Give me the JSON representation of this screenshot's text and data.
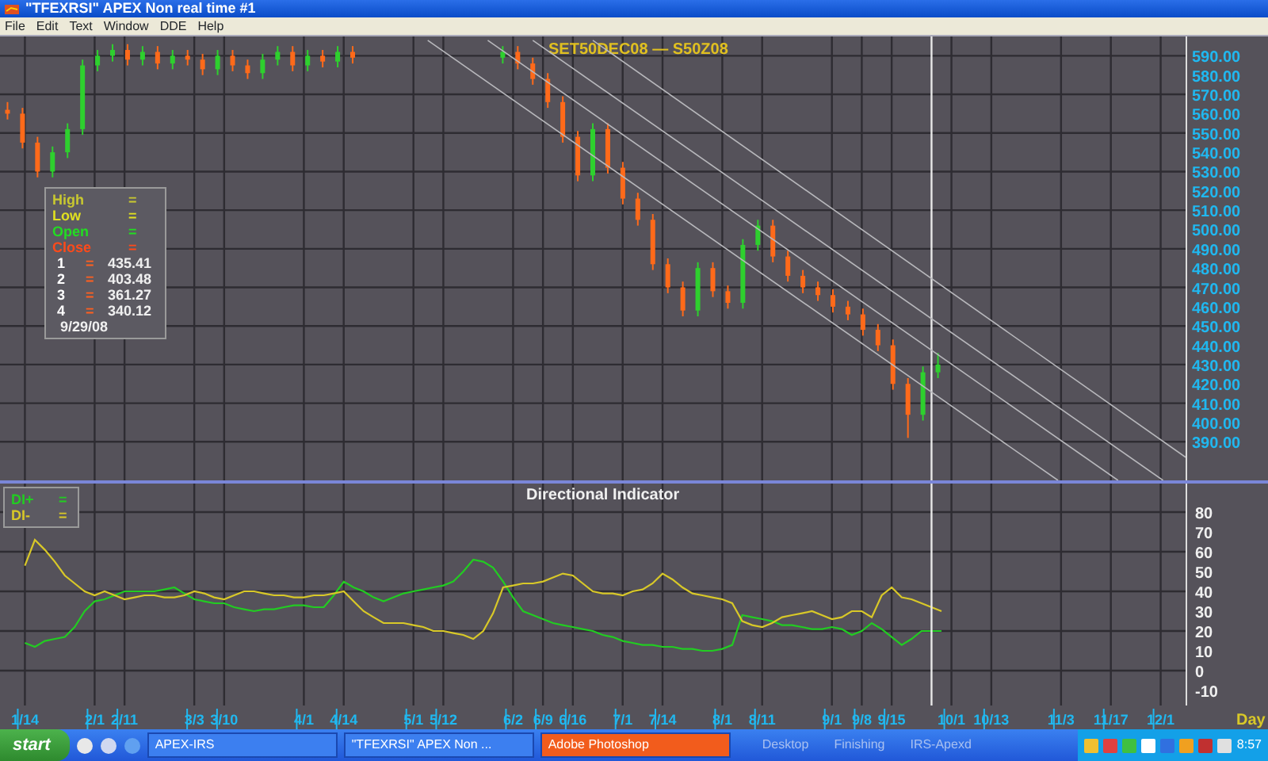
{
  "window": {
    "title": "\"TFEXRSI\" APEX Non real time #1"
  },
  "menu": [
    "File",
    "Edit",
    "Text",
    "Window",
    "DDE",
    "Help"
  ],
  "price_panel": {
    "legend": {
      "fields": [
        {
          "label": "High",
          "sign": "=",
          "color": "#c8c830"
        },
        {
          "label": "Low",
          "sign": "=",
          "color": "#e0e020"
        },
        {
          "label": "Open",
          "sign": "=",
          "color": "#22dd22"
        },
        {
          "label": "Close",
          "sign": "=",
          "color": "#ff4a1a"
        }
      ],
      "levels": [
        {
          "label": "1",
          "sign": "=",
          "value": "435.41"
        },
        {
          "label": "2",
          "sign": "=",
          "value": "403.48"
        },
        {
          "label": "3",
          "sign": "=",
          "value": "361.27"
        },
        {
          "label": "4",
          "sign": "=",
          "value": "340.12"
        }
      ],
      "date": "9/29/08"
    },
    "chart_data": {
      "type": "candlestick",
      "title": "SET50DEC08  —  S50Z08",
      "ylim": [
        370,
        600
      ],
      "grid": true,
      "categories": [
        null,
        null,
        null,
        null,
        null,
        null,
        null,
        null,
        null,
        null,
        null,
        null,
        null,
        null,
        null,
        null,
        null,
        null,
        null,
        null,
        null,
        null,
        null,
        null,
        null,
        null,
        null,
        null,
        null,
        null,
        null,
        null,
        null,
        null,
        null,
        null,
        null,
        null,
        null,
        null,
        null,
        null,
        null,
        null,
        null,
        null,
        null,
        null,
        null,
        null,
        null,
        null,
        null,
        null,
        null,
        null,
        null,
        null,
        null,
        null,
        null,
        null,
        null,
        null,
        null,
        null,
        null,
        null,
        null,
        null,
        null,
        null,
        null,
        null,
        null,
        null,
        null,
        null,
        null
      ],
      "ohlc": [
        [
          562,
          566,
          557,
          560
        ],
        [
          560,
          563,
          542,
          545
        ],
        [
          545,
          548,
          527,
          530
        ],
        [
          530,
          543,
          527,
          540
        ],
        [
          540,
          555,
          537,
          552
        ],
        [
          552,
          588,
          549,
          585
        ],
        [
          585,
          593,
          582,
          590
        ],
        [
          590,
          596,
          587,
          593
        ],
        [
          593,
          596,
          585,
          588
        ],
        [
          588,
          595,
          585,
          592
        ],
        [
          592,
          595,
          583,
          586
        ],
        [
          586,
          593,
          583,
          590
        ],
        [
          590,
          593,
          585,
          588
        ],
        [
          588,
          591,
          580,
          583
        ],
        [
          583,
          593,
          580,
          590
        ],
        [
          590,
          593,
          582,
          585
        ],
        [
          585,
          588,
          578,
          581
        ],
        [
          581,
          591,
          578,
          588
        ],
        [
          588,
          595,
          585,
          592
        ],
        [
          592,
          595,
          582,
          585
        ],
        [
          585,
          593,
          582,
          590
        ],
        [
          590,
          593,
          584,
          587
        ],
        [
          587,
          595,
          584,
          592
        ],
        [
          592,
          595,
          586,
          589
        ],
        null,
        null,
        null,
        null,
        null,
        null,
        null,
        null,
        null,
        [
          589,
          595,
          586,
          592
        ],
        [
          592,
          595,
          583,
          586
        ],
        [
          586,
          589,
          575,
          578
        ],
        [
          578,
          581,
          563,
          566
        ],
        [
          566,
          569,
          545,
          548
        ],
        [
          548,
          551,
          525,
          528
        ],
        [
          528,
          555,
          525,
          552
        ],
        [
          552,
          555,
          529,
          532
        ],
        [
          532,
          535,
          513,
          516
        ],
        [
          516,
          519,
          502,
          505
        ],
        [
          505,
          508,
          479,
          482
        ],
        [
          482,
          485,
          467,
          470
        ],
        [
          470,
          473,
          455,
          458
        ],
        [
          458,
          483,
          455,
          480
        ],
        [
          480,
          483,
          465,
          468
        ],
        [
          468,
          471,
          459,
          462
        ],
        [
          462,
          495,
          459,
          492
        ],
        [
          492,
          505,
          489,
          502
        ],
        [
          502,
          505,
          483,
          486
        ],
        [
          486,
          489,
          473,
          476
        ],
        [
          476,
          479,
          467,
          470
        ],
        [
          470,
          473,
          463,
          466
        ],
        [
          466,
          469,
          457,
          460
        ],
        [
          460,
          463,
          453,
          456
        ],
        [
          456,
          459,
          445,
          448
        ],
        [
          448,
          451,
          437,
          440
        ],
        [
          440,
          443,
          417,
          420
        ],
        [
          420,
          423,
          392,
          404
        ],
        [
          404,
          429,
          401,
          426
        ],
        [
          426,
          436,
          423,
          430
        ],
        null,
        null,
        null,
        null,
        null,
        null,
        null,
        null,
        null,
        null,
        null,
        null,
        null,
        null,
        null,
        null
      ],
      "yticks": [
        {
          "value": 390,
          "label": "390.00"
        },
        {
          "value": 400,
          "label": "400.00"
        },
        {
          "value": 410,
          "label": "410.00"
        },
        {
          "value": 420,
          "label": "420.00"
        },
        {
          "value": 430,
          "label": "430.00"
        },
        {
          "value": 440,
          "label": "440.00"
        },
        {
          "value": 450,
          "label": "450.00"
        },
        {
          "value": 460,
          "label": "460.00"
        },
        {
          "value": 470,
          "label": "470.00"
        },
        {
          "value": 480,
          "label": "480.00"
        },
        {
          "value": 490,
          "label": "490.00"
        },
        {
          "value": 500,
          "label": "500.00"
        },
        {
          "value": 510,
          "label": "510.00"
        },
        {
          "value": 520,
          "label": "520.00"
        },
        {
          "value": 530,
          "label": "530.00"
        },
        {
          "value": 540,
          "label": "540.00"
        },
        {
          "value": 550,
          "label": "550.00"
        },
        {
          "value": 560,
          "label": "560.00"
        },
        {
          "value": 570,
          "label": "570.00"
        },
        {
          "value": 580,
          "label": "580.00"
        },
        {
          "value": 590,
          "label": "590.00"
        }
      ]
    }
  },
  "indicator_panel": {
    "legend": [
      {
        "sign": "="
      },
      {
        "sign": "="
      }
    ],
    "chart_data": {
      "type": "line",
      "title": "Directional  Indicator",
      "xlabel": "Day",
      "ylim": [
        -15,
        85
      ],
      "grid": true,
      "categories": [
        null,
        null,
        "1/14",
        null,
        null,
        null,
        null,
        null,
        null,
        "2/1",
        null,
        null,
        "2/11",
        null,
        null,
        null,
        null,
        null,
        null,
        "3/3",
        null,
        null,
        "3/10",
        null,
        null,
        null,
        null,
        null,
        null,
        null,
        "4/1",
        null,
        null,
        null,
        "4/14",
        null,
        null,
        null,
        null,
        null,
        null,
        "5/1",
        null,
        null,
        "5/12",
        null,
        null,
        null,
        null,
        null,
        null,
        "6/2",
        null,
        null,
        "6/9",
        null,
        null,
        "6/16",
        null,
        null,
        null,
        null,
        "7/1",
        null,
        null,
        null,
        "7/14",
        null,
        null,
        null,
        null,
        null,
        "8/1",
        null,
        null,
        null,
        "8/11",
        null,
        null,
        null,
        null,
        null,
        null,
        "9/1",
        null,
        null,
        "9/8",
        null,
        null,
        "9/15",
        null,
        null,
        null,
        null,
        null,
        "10/1",
        null,
        null,
        null,
        "10/13",
        null,
        null,
        null,
        null,
        null,
        null,
        "11/3",
        null,
        null,
        null,
        null,
        "11/17",
        null,
        null,
        null,
        null,
        "12/1",
        null,
        null
      ],
      "series": [
        {
          "name": "DI+",
          "color": "#22cc22",
          "values": [
            null,
            null,
            14,
            12,
            15,
            16,
            17,
            22,
            30,
            35,
            36,
            38,
            40,
            40,
            40,
            40,
            41,
            42,
            39,
            36,
            35,
            34,
            34,
            32,
            31,
            30,
            31,
            31,
            32,
            33,
            33,
            32,
            32,
            38,
            45,
            42,
            40,
            37,
            35,
            37,
            39,
            40,
            41,
            42,
            43,
            45,
            50,
            56,
            55,
            52,
            45,
            37,
            30,
            28,
            26,
            24,
            23,
            22,
            21,
            20,
            18,
            17,
            15,
            14,
            13,
            13,
            12,
            12,
            11,
            11,
            10,
            10,
            11,
            13,
            28,
            27,
            26,
            25,
            23,
            23,
            22,
            21,
            21,
            22,
            21,
            18,
            20,
            24,
            21,
            17,
            13,
            16,
            20,
            20,
            20,
            null,
            null,
            null,
            null,
            null,
            null,
            null,
            null,
            null,
            null,
            null,
            null,
            null,
            null,
            null,
            null,
            null,
            null,
            null,
            null,
            null,
            null,
            null,
            null
          ]
        },
        {
          "name": "DI-",
          "color": "#d8c828",
          "values": [
            null,
            null,
            53,
            66,
            61,
            55,
            48,
            44,
            40,
            38,
            40,
            38,
            36,
            37,
            38,
            38,
            37,
            37,
            38,
            40,
            39,
            37,
            36,
            38,
            40,
            40,
            39,
            38,
            38,
            37,
            37,
            38,
            38,
            39,
            40,
            35,
            30,
            27,
            24,
            24,
            24,
            23,
            22,
            20,
            20,
            19,
            18,
            16,
            20,
            29,
            42,
            43,
            44,
            44,
            45,
            47,
            49,
            48,
            44,
            40,
            39,
            39,
            38,
            40,
            41,
            44,
            49,
            46,
            42,
            39,
            38,
            37,
            36,
            34,
            25,
            23,
            22,
            24,
            27,
            28,
            29,
            30,
            28,
            26,
            27,
            30,
            30,
            27,
            38,
            42,
            37,
            36,
            34,
            32,
            30,
            null,
            null,
            null,
            null,
            null,
            null,
            null,
            null,
            null,
            null,
            null,
            null,
            null,
            null,
            null,
            null,
            null,
            null,
            null,
            null,
            null,
            null,
            null,
            null
          ]
        }
      ],
      "yticks": [
        -10,
        0,
        10,
        20,
        30,
        40,
        50,
        60,
        70,
        80
      ]
    }
  },
  "taskbar": {
    "start": "start",
    "tasks": [
      {
        "label": "APEX-IRS",
        "selected": false
      },
      {
        "label": "\"TFEXRSI\" APEX Non ...",
        "selected": false
      },
      {
        "label": "Adobe Photoshop",
        "selected": true
      }
    ],
    "toolbars": [
      "Desktop",
      "Finishing",
      "IRS-Apexd"
    ],
    "clock": "8:57"
  }
}
